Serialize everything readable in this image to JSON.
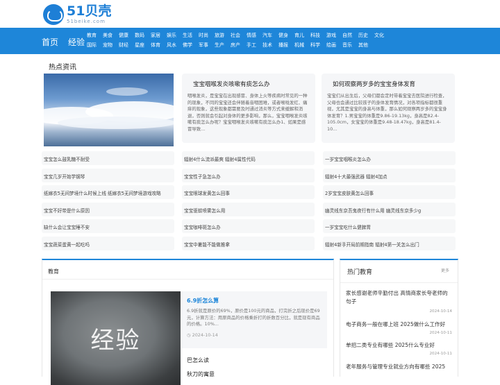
{
  "site": {
    "name": "51贝壳",
    "url": "51beike.com"
  },
  "nav": {
    "home": "首页",
    "experience": "经验",
    "row1": [
      "教育",
      "美食",
      "健康",
      "数码",
      "家居",
      "娱乐",
      "生活",
      "时尚",
      "旅游",
      "社会",
      "情感",
      "汽车",
      "健身",
      "育儿",
      "科技",
      "游戏",
      "自然",
      "历史",
      "文化"
    ],
    "row2": [
      "国际",
      "宠物",
      "财经",
      "星座",
      "体育",
      "风水",
      "佛学",
      "军事",
      "生产",
      "房产",
      "手工",
      "技术",
      "播报",
      "机械",
      "科学",
      "绘画",
      "音乐",
      "其他"
    ]
  },
  "hot": {
    "title": "热点资讯",
    "cards": [
      {
        "title": "宝宝咽喉发炎咳嗽有痰怎么办",
        "body": "咽喉发炎，是宝宝在出现感冒、身体上火等疾病时常见的一种的现象，不同的宝宝还会伴随着音咽困难，或者喉咙发红、痛痒的现象，这些现象都需要及时通过消炎等方式来缓解和消退，否则就会引起对身体的更多影响，那么，宝宝咽喉发炎咳嗽有痰怎么办呢？宝宝咽喉发炎咳嗽有痰怎么办1、如果是感冒导致..."
      },
      {
        "title": "如何观察两岁多的宝宝身体发育",
        "body": "宝宝们从出生后，父母们都会定时带着宝宝去医院进行检查，父母也会通过比较孩子的身体发育情况，对各项指标都很重视，尤其是宝宝的身高与体重，那么如何观察两岁多的宝宝身体发育？1.男宝宝的体重是9.86-19.13kg，身高是82.4-105.0cm，女宝宝的体重是9.48-18.47kg，身高是81.4-10..."
      }
    ],
    "lists": [
      [
        "宝宝怎么鼓乳糖不耐受",
        "宝宝几岁开始学钢琴",
        "纸嫁衣5无间梦境什么时候上线 纸嫁衣5无间梦境游戏攻略",
        "宝宝不好带是什么原因",
        "缺什么会让宝宝睡不安",
        "宝宝蔬菜蛋黄一起吃吗"
      ],
      [
        "辐射4什么流派最爽 辐射4属性代码",
        "宝宝性子急怎么办",
        "宝宝眼球发黄怎么回事",
        "宝宝驱蚊喷雾怎么用",
        "宝宝咖啡斑怎么办",
        "宝宝中暑能不能做推拿"
      ],
      [
        "一岁宝宝咽喉炎怎么办",
        "辐射4十大最强武器 辐射4加点",
        "2岁宝宝皮肤黄怎么回事",
        "幽灵线东京吾鬼夜行有什么用 幽灵线东京多少g",
        "一岁宝宝吃什么健脾胃",
        "辐射4新手开局前期指南 辐射4第一关怎么出门"
      ]
    ]
  },
  "education": {
    "title": "教育",
    "thumb_text": "经验",
    "feature": {
      "title": "6.9折怎么算",
      "body": "6.9折就是原价的69%，原价是100元的商品，打完折之后现价是69元，计算方法：用原商品的价格乘折打的折数百分比，就是现有商品的价格。10%...",
      "date": "2024-10-14"
    },
    "links": [
      "巴怎么读",
      "秋刀的寓意"
    ]
  },
  "hot_edu": {
    "title": "热门教育",
    "more": "更多",
    "items": [
      {
        "text": "家长感谢老师辛勤付出 高情商家长夸老师的句子",
        "date": "2024-10-14"
      },
      {
        "text": "电子商务一般在哪上班 2025做什么工作好",
        "date": "2024-10-11"
      },
      {
        "text": "单招二类专业有哪些 2025什么专业好",
        "date": "2024-10-11"
      },
      {
        "text": "老年服务与管理专业就业方向有哪些 2025",
        "date": ""
      }
    ]
  }
}
